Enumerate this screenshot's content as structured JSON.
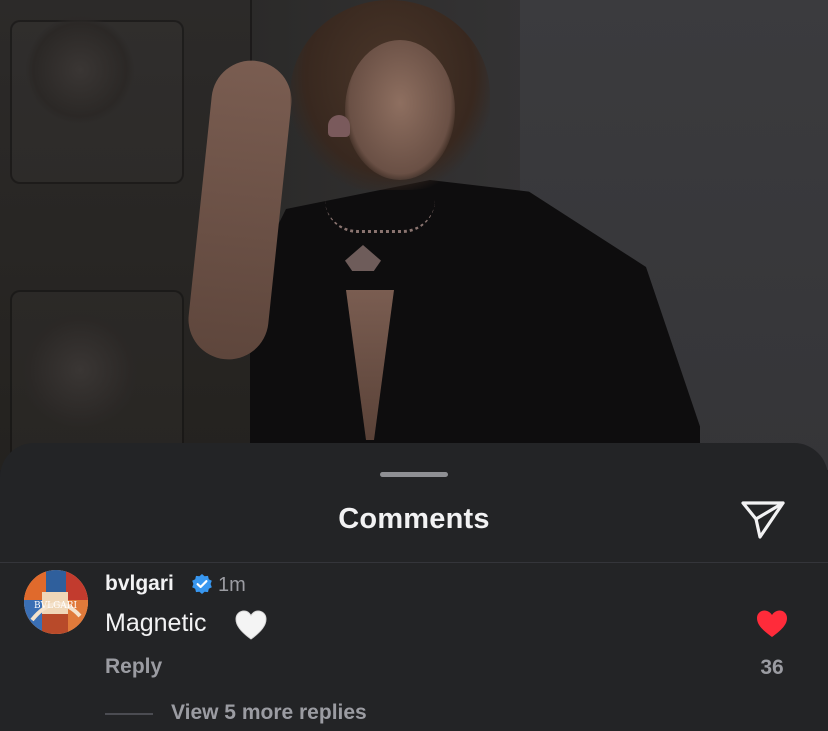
{
  "sheet": {
    "title": "Comments",
    "icons": {
      "grabber": "drag-handle",
      "send": "paper-plane-icon"
    }
  },
  "comment": {
    "username": "bvlgari",
    "verified": true,
    "time": "1m",
    "text": "Magnetic",
    "emoji": "white-heart",
    "reply_label": "Reply",
    "like_count": "36",
    "liked": true,
    "view_replies_label": "View 5 more replies"
  },
  "colors": {
    "sheet_bg": "#232426",
    "text_primary": "#f2f2f3",
    "text_secondary": "#9b9ca2",
    "like_red": "#ff2b3a",
    "verified_blue": "#3897f0"
  }
}
